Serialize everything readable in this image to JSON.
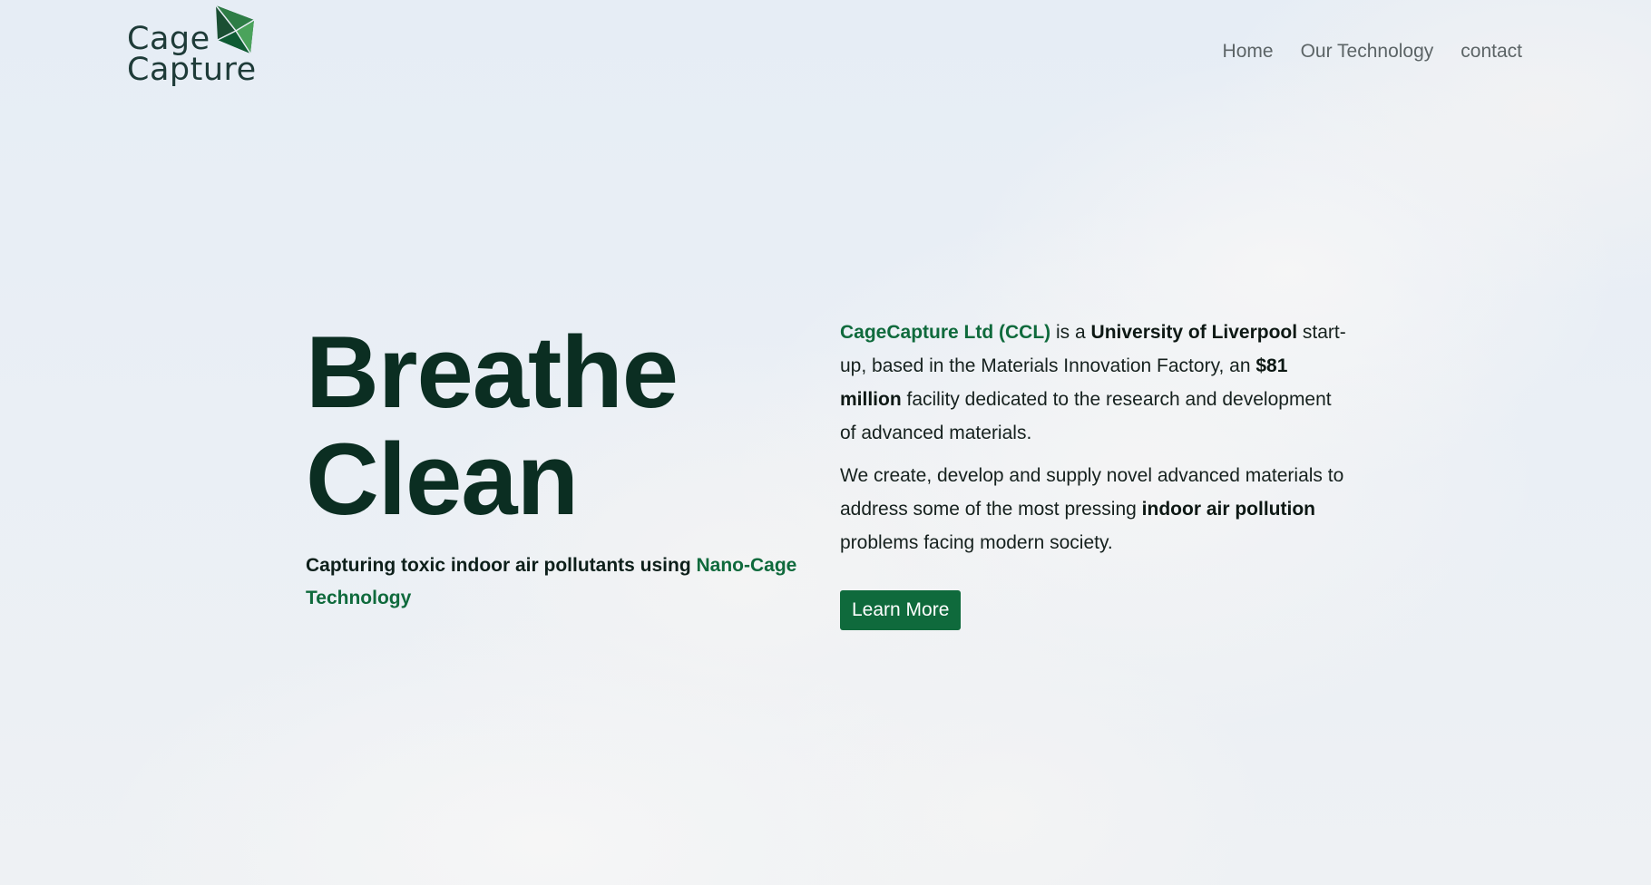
{
  "brand": {
    "logo_line1": "Cage",
    "logo_line2": "Capture",
    "icon": "green-diamond-logo-icon",
    "accent_color": "#0f6a3c",
    "dark_color": "#0b2e22"
  },
  "nav": {
    "items": [
      "Home",
      "Our Technology",
      "contact"
    ]
  },
  "hero": {
    "headline_line1": "Breathe",
    "headline_line2": "Clean",
    "tagline_prefix": "Capturing toxic indoor air pollutants using ",
    "tagline_accent": "Nano-Cage Technology"
  },
  "about": {
    "p1_company": "CageCapture Ltd (CCL)",
    "p1_text1": " is a ",
    "p1_university": "University of Liverpool",
    "p1_text2": " start-up, based in the Materials Innovation Factory, an ",
    "p1_amount": "$81 million",
    "p1_text3": " facility dedicated to the research and development of advanced materials.",
    "p2_text1": "We create, develop and supply novel advanced materials to address some of the most pressing ",
    "p2_bold": "indoor air pollution",
    "p2_text2": " problems facing modern society.",
    "cta_label": "Learn More"
  }
}
